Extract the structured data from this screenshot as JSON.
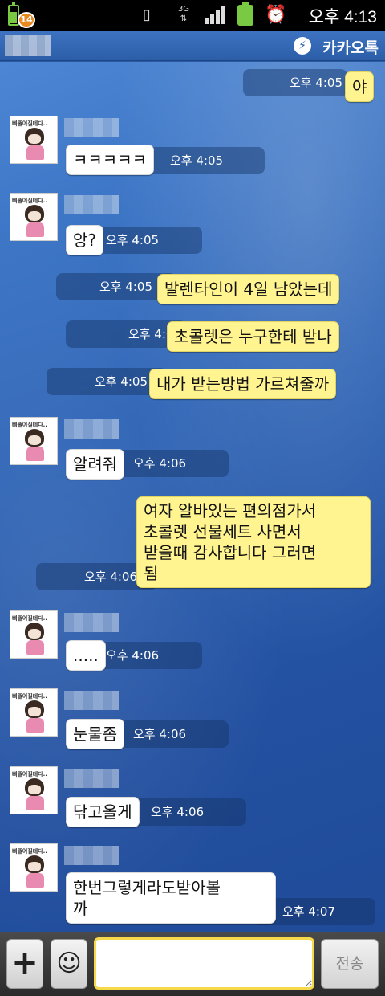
{
  "status_bar": {
    "notification_count": "14",
    "network": "3G",
    "time": "오후 4:13",
    "icons": [
      "battery-icon",
      "vibrate-icon",
      "network-3g-icon",
      "signal-icon",
      "battery-icon",
      "alarm-icon"
    ]
  },
  "header": {
    "app_name": "카카오톡",
    "logo_icon": "kakaotalk-icon"
  },
  "avatar_caption": "삐뚤어질테다..",
  "messages": [
    {
      "from": "me",
      "text": "야",
      "time": "오후 4:05"
    },
    {
      "from": "other",
      "text": "ㅋㅋㅋㅋㅋ",
      "time": "오후 4:05"
    },
    {
      "from": "other",
      "text": "앙?",
      "time": "오후 4:05"
    },
    {
      "from": "me",
      "text": "발렌타인이 4일 남았는데",
      "time": "오후 4:05"
    },
    {
      "from": "me",
      "text": "초콜렛은 누구한테 받나",
      "time": "오후 4:05"
    },
    {
      "from": "me",
      "text": "내가 받는방법 가르쳐줄까",
      "time": "오후 4:05"
    },
    {
      "from": "other",
      "text": "알려줘",
      "time": "오후 4:06"
    },
    {
      "from": "me",
      "lines": [
        "여자 알바있는 편의점가서",
        "초콜렛 선물세트 사면서",
        "받을때 감사합니다 그러면",
        "됨"
      ],
      "time": "오후 4:06"
    },
    {
      "from": "other",
      "text": ".....",
      "time": "오후 4:06"
    },
    {
      "from": "other",
      "text": "눈물좀",
      "time": "오후 4:06"
    },
    {
      "from": "other",
      "text": "닦고올게",
      "time": "오후 4:06"
    },
    {
      "from": "other",
      "lines": [
        "한번그렇게라도받아볼",
        "까"
      ],
      "time": "오후 4:07"
    }
  ],
  "input_bar": {
    "plus_label": "+",
    "emoji_label": "☺",
    "input_value": "",
    "send_label": "전송"
  },
  "colors": {
    "my_bubble": "#fff48f",
    "other_bubble": "#ffffff",
    "header": "#2c5ea8",
    "background": "#2b62b5"
  }
}
